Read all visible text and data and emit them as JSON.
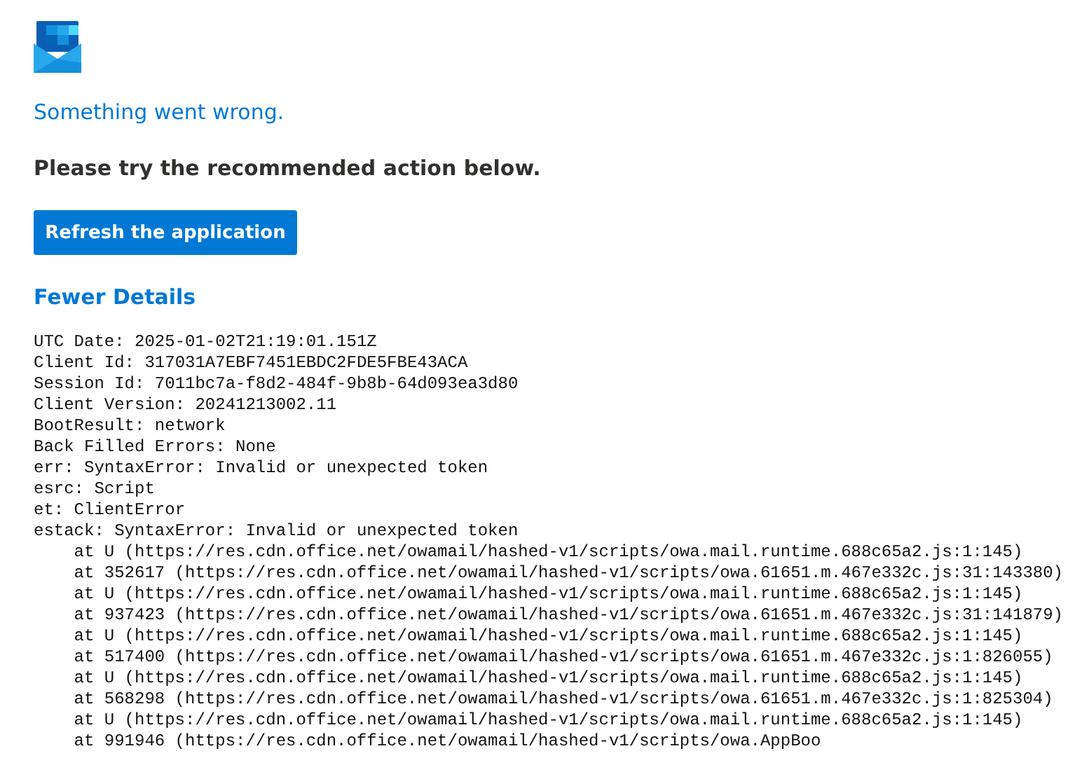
{
  "error_title": "Something went wrong.",
  "instruction": "Please try the recommended action below.",
  "refresh_button": "Refresh the application",
  "details_toggle": {
    "label": "Fewer Details",
    "expanded": true
  },
  "details": [
    {
      "text": "UTC Date: 2025-01-02T21:19:01.151Z"
    },
    {
      "text": "Client Id: 317031A7EBF7451EBDC2FDE5FBE43ACA"
    },
    {
      "text": "Session Id: 7011bc7a-f8d2-484f-9b8b-64d093ea3d80"
    },
    {
      "text": "Client Version: 20241213002.11"
    },
    {
      "text": "BootResult: network"
    },
    {
      "text": "Back Filled Errors: None"
    },
    {
      "text": "err: SyntaxError: Invalid or unexpected token"
    },
    {
      "text": "esrc: Script"
    },
    {
      "text": "et: ClientError"
    },
    {
      "text": "estack: SyntaxError: Invalid or unexpected token",
      "children": [
        {
          "text": "at U (https://res.cdn.office.net/owamail/hashed-v1/scripts/owa.mail.runtime.688c65a2.js:1:145)"
        },
        {
          "text": "at 352617 (https://res.cdn.office.net/owamail/hashed-v1/scripts/owa.61651.m.467e332c.js:31:143380)"
        },
        {
          "text": "at U (https://res.cdn.office.net/owamail/hashed-v1/scripts/owa.mail.runtime.688c65a2.js:1:145)"
        },
        {
          "text": "at 937423 (https://res.cdn.office.net/owamail/hashed-v1/scripts/owa.61651.m.467e332c.js:31:141879)"
        },
        {
          "text": "at U (https://res.cdn.office.net/owamail/hashed-v1/scripts/owa.mail.runtime.688c65a2.js:1:145)"
        },
        {
          "text": "at 517400 (https://res.cdn.office.net/owamail/hashed-v1/scripts/owa.61651.m.467e332c.js:1:826055)"
        },
        {
          "text": "at U (https://res.cdn.office.net/owamail/hashed-v1/scripts/owa.mail.runtime.688c65a2.js:1:145)"
        },
        {
          "text": "at 568298 (https://res.cdn.office.net/owamail/hashed-v1/scripts/owa.61651.m.467e332c.js:1:825304)"
        },
        {
          "text": "at U (https://res.cdn.office.net/owamail/hashed-v1/scripts/owa.mail.runtime.688c65a2.js:1:145)"
        },
        {
          "text": "at 991946 (https://res.cdn.office.net/owamail/hashed-v1/scripts/owa.AppBoo"
        }
      ]
    }
  ]
}
